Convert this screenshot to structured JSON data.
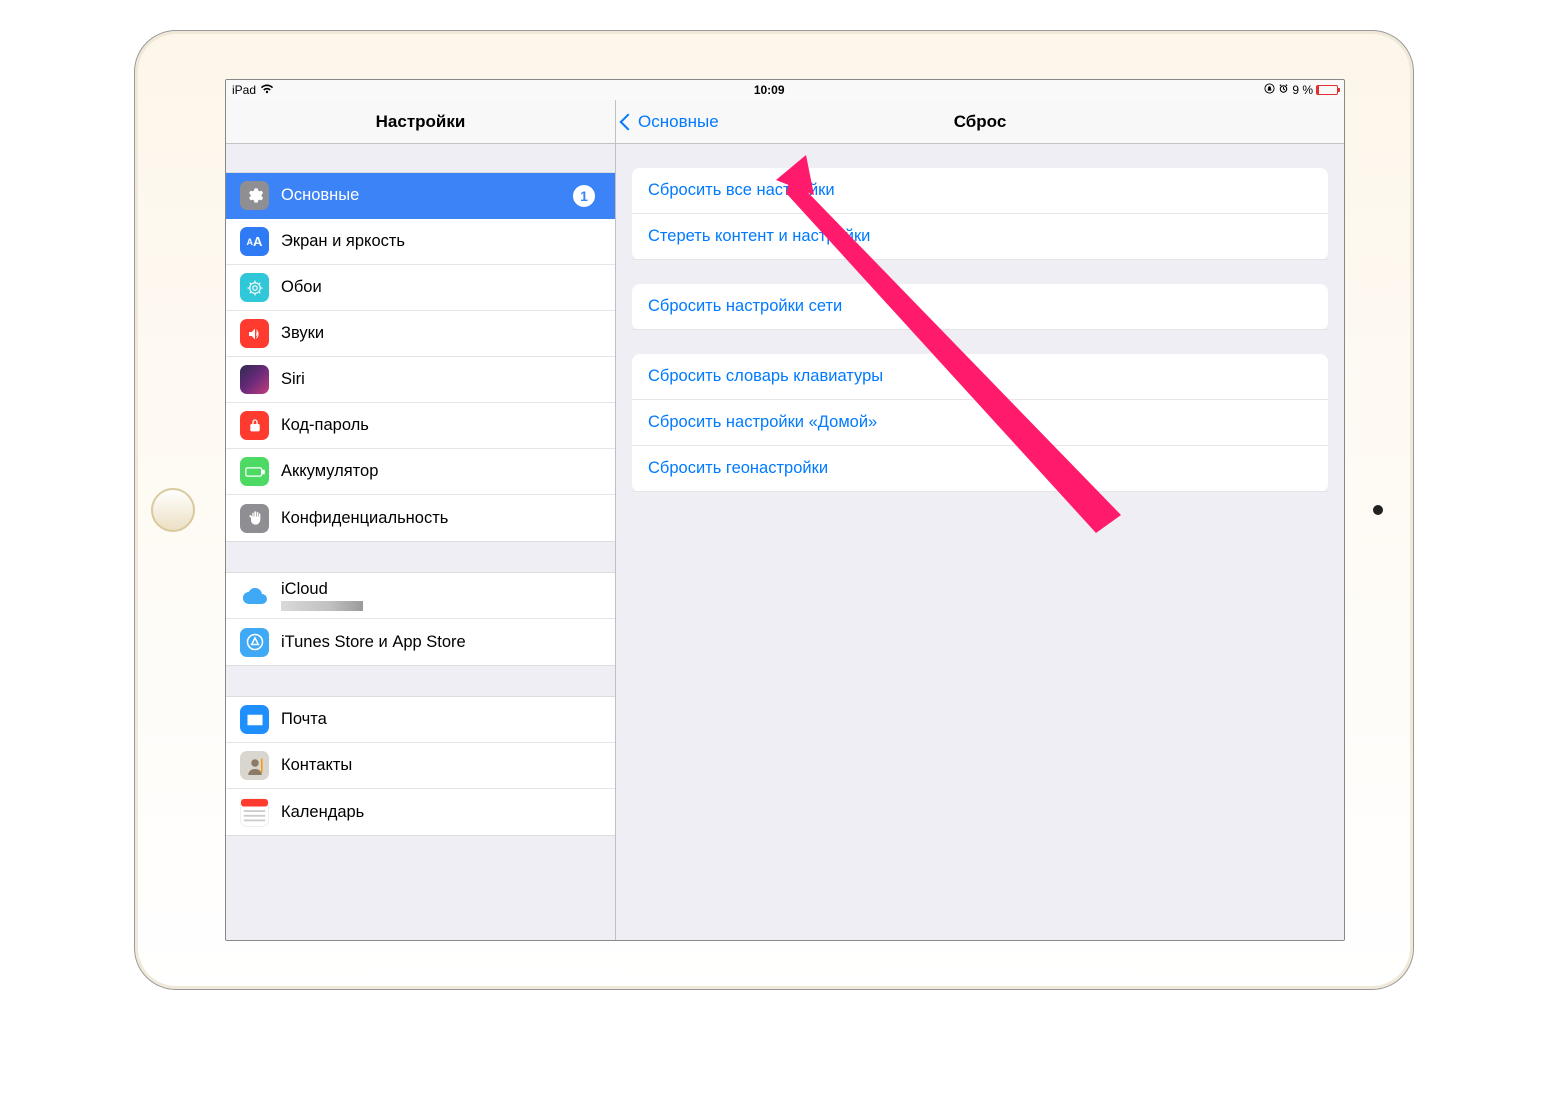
{
  "statusbar": {
    "device": "iPad",
    "time": "10:09",
    "battery": "9 %"
  },
  "sidebar": {
    "title": "Настройки",
    "general": {
      "label": "Основные",
      "badge": "1"
    },
    "display": "Экран и яркость",
    "wallpaper": "Обои",
    "sounds": "Звуки",
    "siri": "Siri",
    "passcode": "Код-пароль",
    "battery": "Аккумулятор",
    "privacy": "Конфиденциальность",
    "icloud": "iCloud",
    "itunes": "iTunes Store и App Store",
    "mail": "Почта",
    "contacts": "Контакты",
    "calendar": "Календарь"
  },
  "detail": {
    "back": "Основные",
    "title": "Сброс",
    "g1": {
      "resetAll": "Сбросить все настройки",
      "erase": "Стереть контент и настройки"
    },
    "g2": {
      "network": "Сбросить настройки сети"
    },
    "g3": {
      "keyboard": "Сбросить словарь клавиатуры",
      "home": "Сбросить настройки «Домой»",
      "location": "Сбросить геонастройки"
    }
  }
}
